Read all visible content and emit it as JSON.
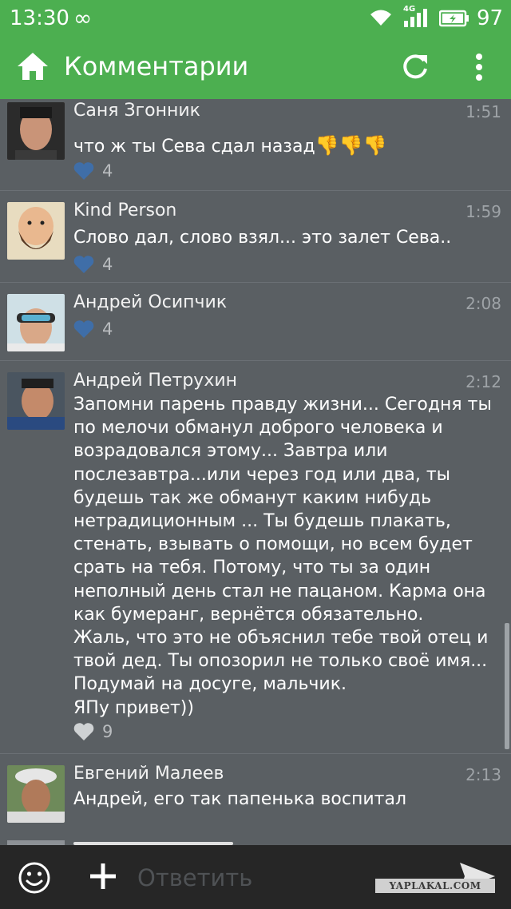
{
  "status_bar": {
    "time": "13:30",
    "infinity_glyph": "∞",
    "network": "4G",
    "battery_percent": "97"
  },
  "toolbar": {
    "title": "Комментарии",
    "home_icon": "home-icon",
    "refresh_icon": "refresh-icon",
    "menu_icon": "more-vert-icon"
  },
  "comments": [
    {
      "author": "Саня Згонник",
      "time": "1:51",
      "text": "что ж ты Сева сдал назад",
      "emoji": "👎👎👎",
      "likes": "4",
      "liked": true
    },
    {
      "author": "Kind Person",
      "time": "1:59",
      "text": "Слово дал, слово взял... это залет Сева..",
      "likes": "4",
      "liked": true
    },
    {
      "author": "Андрей Осипчик",
      "time": "2:08",
      "text": "",
      "likes": "4",
      "liked": true
    },
    {
      "author": "Андрей Петрухин",
      "time": "2:12",
      "lines": [
        "Запомни парень правду жизни... Сегодня ты",
        "по мелочи обманул доброго человека и",
        "возрадовался этому... Завтра или",
        "послезавтра...или через год или два, ты",
        "будешь так же обманут каким нибудь",
        "нетрадиционным ... Ты будешь плакать,",
        "стенать, взывать о помощи, но всем будет",
        "срать на тебя. Потому, что ты за один",
        "неполный день стал не пацаном. Карма она",
        "как бумеранг, вернётся обязательно.",
        "Жаль, что это не объяснил тебе твой отец и",
        "твой дед. Ты опозорил не только своё имя...",
        "Подумай на досуге, мальчик.",
        "ЯПу привет))"
      ],
      "likes": "9",
      "liked": false
    },
    {
      "author": "Евгений Малеев",
      "time": "2:13",
      "text": "Андрей, его так папенька воспитал"
    }
  ],
  "bottom_bar": {
    "reply_placeholder": "Ответить",
    "watermark": "YAPLAKAL.COM"
  },
  "colors": {
    "accent": "#4caf50",
    "background": "#5a5f63",
    "liked_heart": "#3f6ea8",
    "unliked_heart": "#cfd2d4"
  }
}
